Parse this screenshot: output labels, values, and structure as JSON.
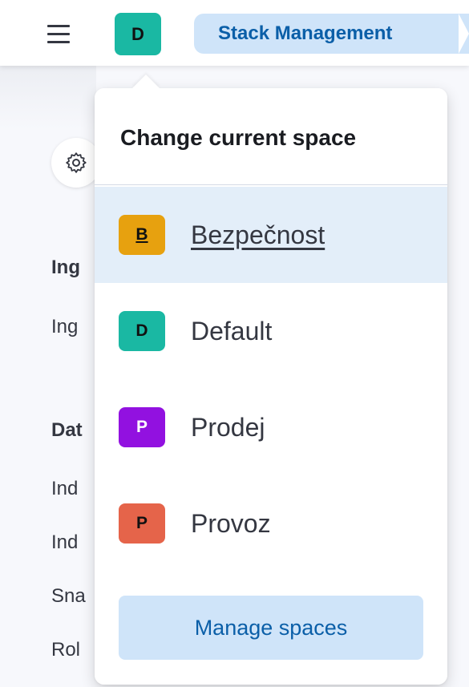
{
  "header": {
    "current_space_initial": "D",
    "breadcrumb": "Stack Management"
  },
  "nav": {
    "group1_heading": "Ing",
    "group1_items": [
      "Ing"
    ],
    "group2_heading": "Dat",
    "group2_items": [
      "Ind",
      "Ind",
      "Sna",
      "Rol"
    ]
  },
  "popover": {
    "title": "Change current space",
    "spaces": [
      {
        "initial": "B",
        "name": "Bezpečnost",
        "color": "#e7a10f",
        "text_color": "#111111",
        "selected": true
      },
      {
        "initial": "D",
        "name": "Default",
        "color": "#1ab8a3",
        "text_color": "#111111",
        "selected": false
      },
      {
        "initial": "P",
        "name": "Prodej",
        "color": "#9211e0",
        "text_color": "#ffffff",
        "selected": false
      },
      {
        "initial": "P",
        "name": "Provoz",
        "color": "#e5644a",
        "text_color": "#111111",
        "selected": false
      }
    ],
    "manage_label": "Manage spaces"
  },
  "colors": {
    "accent": "#0b5fa8",
    "accent_bg": "#cfe4f9",
    "selected_row_bg": "#e3eef9"
  },
  "icons": {
    "menu": "hamburger-menu-icon",
    "gear": "gear-icon"
  }
}
